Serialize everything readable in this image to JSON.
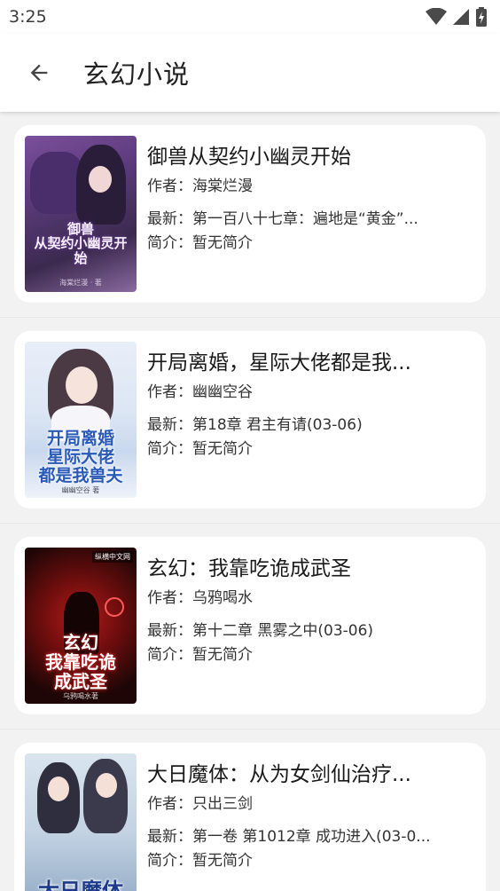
{
  "status": {
    "time": "3:25"
  },
  "header": {
    "title": "玄幻小说"
  },
  "labels": {
    "author": "作者：",
    "latest": "最新：",
    "intro": "简介："
  },
  "books": [
    {
      "title": "御兽从契约小幽灵开始",
      "author": "海棠烂漫",
      "latest": "第一百八十七章：遍地是“黄金”...",
      "intro": "暂无简介",
      "cover_text": "御兽\n从契约小幽灵开始",
      "cover_author": "海棠烂漫 · 著"
    },
    {
      "title": "开局离婚，星际大佬都是我...",
      "author": "幽幽空谷",
      "latest": "第18章 君主有请(03-06)",
      "intro": "暂无简介",
      "cover_text": "开局离婚\n星际大佬\n都是我兽夫",
      "cover_author": "幽幽空谷 著"
    },
    {
      "title": "玄幻：我靠吃诡成武圣",
      "author": "乌鸦喝水",
      "latest": "第十二章 黑雾之中(03-06)",
      "intro": "暂无简介",
      "cover_badge": "纵横中文网",
      "cover_text": "玄幻\n我靠吃诡\n成武圣",
      "cover_author": "乌鸦喝水著"
    },
    {
      "title": "大日魔体：从为女剑仙治疗...",
      "author": "只出三剑",
      "latest": "第一卷 第1012章 成功进入(03-0...",
      "intro": "暂无简介",
      "cover_text": "大日魔体"
    }
  ]
}
